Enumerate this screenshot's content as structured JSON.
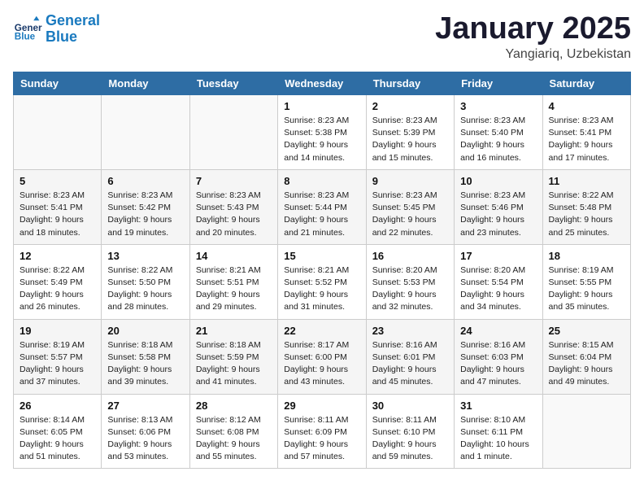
{
  "header": {
    "logo_line1": "General",
    "logo_line2": "Blue",
    "month": "January 2025",
    "location": "Yangiariq, Uzbekistan"
  },
  "weekdays": [
    "Sunday",
    "Monday",
    "Tuesday",
    "Wednesday",
    "Thursday",
    "Friday",
    "Saturday"
  ],
  "weeks": [
    [
      {
        "day": "",
        "info": ""
      },
      {
        "day": "",
        "info": ""
      },
      {
        "day": "",
        "info": ""
      },
      {
        "day": "1",
        "info": "Sunrise: 8:23 AM\nSunset: 5:38 PM\nDaylight: 9 hours and 14 minutes."
      },
      {
        "day": "2",
        "info": "Sunrise: 8:23 AM\nSunset: 5:39 PM\nDaylight: 9 hours and 15 minutes."
      },
      {
        "day": "3",
        "info": "Sunrise: 8:23 AM\nSunset: 5:40 PM\nDaylight: 9 hours and 16 minutes."
      },
      {
        "day": "4",
        "info": "Sunrise: 8:23 AM\nSunset: 5:41 PM\nDaylight: 9 hours and 17 minutes."
      }
    ],
    [
      {
        "day": "5",
        "info": "Sunrise: 8:23 AM\nSunset: 5:41 PM\nDaylight: 9 hours and 18 minutes."
      },
      {
        "day": "6",
        "info": "Sunrise: 8:23 AM\nSunset: 5:42 PM\nDaylight: 9 hours and 19 minutes."
      },
      {
        "day": "7",
        "info": "Sunrise: 8:23 AM\nSunset: 5:43 PM\nDaylight: 9 hours and 20 minutes."
      },
      {
        "day": "8",
        "info": "Sunrise: 8:23 AM\nSunset: 5:44 PM\nDaylight: 9 hours and 21 minutes."
      },
      {
        "day": "9",
        "info": "Sunrise: 8:23 AM\nSunset: 5:45 PM\nDaylight: 9 hours and 22 minutes."
      },
      {
        "day": "10",
        "info": "Sunrise: 8:23 AM\nSunset: 5:46 PM\nDaylight: 9 hours and 23 minutes."
      },
      {
        "day": "11",
        "info": "Sunrise: 8:22 AM\nSunset: 5:48 PM\nDaylight: 9 hours and 25 minutes."
      }
    ],
    [
      {
        "day": "12",
        "info": "Sunrise: 8:22 AM\nSunset: 5:49 PM\nDaylight: 9 hours and 26 minutes."
      },
      {
        "day": "13",
        "info": "Sunrise: 8:22 AM\nSunset: 5:50 PM\nDaylight: 9 hours and 28 minutes."
      },
      {
        "day": "14",
        "info": "Sunrise: 8:21 AM\nSunset: 5:51 PM\nDaylight: 9 hours and 29 minutes."
      },
      {
        "day": "15",
        "info": "Sunrise: 8:21 AM\nSunset: 5:52 PM\nDaylight: 9 hours and 31 minutes."
      },
      {
        "day": "16",
        "info": "Sunrise: 8:20 AM\nSunset: 5:53 PM\nDaylight: 9 hours and 32 minutes."
      },
      {
        "day": "17",
        "info": "Sunrise: 8:20 AM\nSunset: 5:54 PM\nDaylight: 9 hours and 34 minutes."
      },
      {
        "day": "18",
        "info": "Sunrise: 8:19 AM\nSunset: 5:55 PM\nDaylight: 9 hours and 35 minutes."
      }
    ],
    [
      {
        "day": "19",
        "info": "Sunrise: 8:19 AM\nSunset: 5:57 PM\nDaylight: 9 hours and 37 minutes."
      },
      {
        "day": "20",
        "info": "Sunrise: 8:18 AM\nSunset: 5:58 PM\nDaylight: 9 hours and 39 minutes."
      },
      {
        "day": "21",
        "info": "Sunrise: 8:18 AM\nSunset: 5:59 PM\nDaylight: 9 hours and 41 minutes."
      },
      {
        "day": "22",
        "info": "Sunrise: 8:17 AM\nSunset: 6:00 PM\nDaylight: 9 hours and 43 minutes."
      },
      {
        "day": "23",
        "info": "Sunrise: 8:16 AM\nSunset: 6:01 PM\nDaylight: 9 hours and 45 minutes."
      },
      {
        "day": "24",
        "info": "Sunrise: 8:16 AM\nSunset: 6:03 PM\nDaylight: 9 hours and 47 minutes."
      },
      {
        "day": "25",
        "info": "Sunrise: 8:15 AM\nSunset: 6:04 PM\nDaylight: 9 hours and 49 minutes."
      }
    ],
    [
      {
        "day": "26",
        "info": "Sunrise: 8:14 AM\nSunset: 6:05 PM\nDaylight: 9 hours and 51 minutes."
      },
      {
        "day": "27",
        "info": "Sunrise: 8:13 AM\nSunset: 6:06 PM\nDaylight: 9 hours and 53 minutes."
      },
      {
        "day": "28",
        "info": "Sunrise: 8:12 AM\nSunset: 6:08 PM\nDaylight: 9 hours and 55 minutes."
      },
      {
        "day": "29",
        "info": "Sunrise: 8:11 AM\nSunset: 6:09 PM\nDaylight: 9 hours and 57 minutes."
      },
      {
        "day": "30",
        "info": "Sunrise: 8:11 AM\nSunset: 6:10 PM\nDaylight: 9 hours and 59 minutes."
      },
      {
        "day": "31",
        "info": "Sunrise: 8:10 AM\nSunset: 6:11 PM\nDaylight: 10 hours and 1 minute."
      },
      {
        "day": "",
        "info": ""
      }
    ]
  ]
}
